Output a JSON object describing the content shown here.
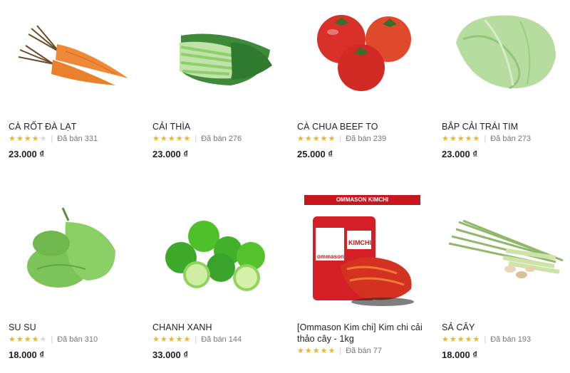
{
  "products": [
    {
      "name": "CÀ RỐT ĐÀ LẠT",
      "rating": 4.5,
      "sold_label": "Đã bán 331",
      "price": "23.000 ₫",
      "image": "carrot-image"
    },
    {
      "name": "CẢI THÌA",
      "rating": 5,
      "sold_label": "Đã bán 276",
      "price": "23.000 ₫",
      "image": "bok-choy-image"
    },
    {
      "name": "CÀ CHUA BEEF TO",
      "rating": 5,
      "sold_label": "Đã bán 239",
      "price": "25.000 ₫",
      "image": "tomato-image"
    },
    {
      "name": "BẮP CẢI TRÁI TIM",
      "rating": 5,
      "sold_label": "Đã bán 273",
      "price": "23.000 ₫",
      "image": "cabbage-image"
    },
    {
      "name": "SU SU",
      "rating": 4.5,
      "sold_label": "Đã bán 310",
      "price": "18.000 ₫",
      "image": "chayote-image"
    },
    {
      "name": "CHANH XANH",
      "rating": 5,
      "sold_label": "Đã bán 144",
      "price": "33.000 ₫",
      "image": "lime-image"
    },
    {
      "name": "[Ommason Kim chi] Kim chi cải thảo cây - 1kg",
      "rating": 5,
      "sold_label": "Đã bán 77",
      "price": "",
      "image": "kimchi-image",
      "banner": "OMMASON KIMCHI",
      "pack_brand": "ommason",
      "pack_label": "KIMCHI"
    },
    {
      "name": "SẢ CÂY",
      "rating": 5,
      "sold_label": "Đã bán 193",
      "price": "18.000 ₫",
      "image": "lemongrass-image"
    }
  ],
  "colors": {
    "star": "#f3b51d",
    "star_empty": "#d9d9d9",
    "text": "#222222",
    "muted": "#777777"
  }
}
